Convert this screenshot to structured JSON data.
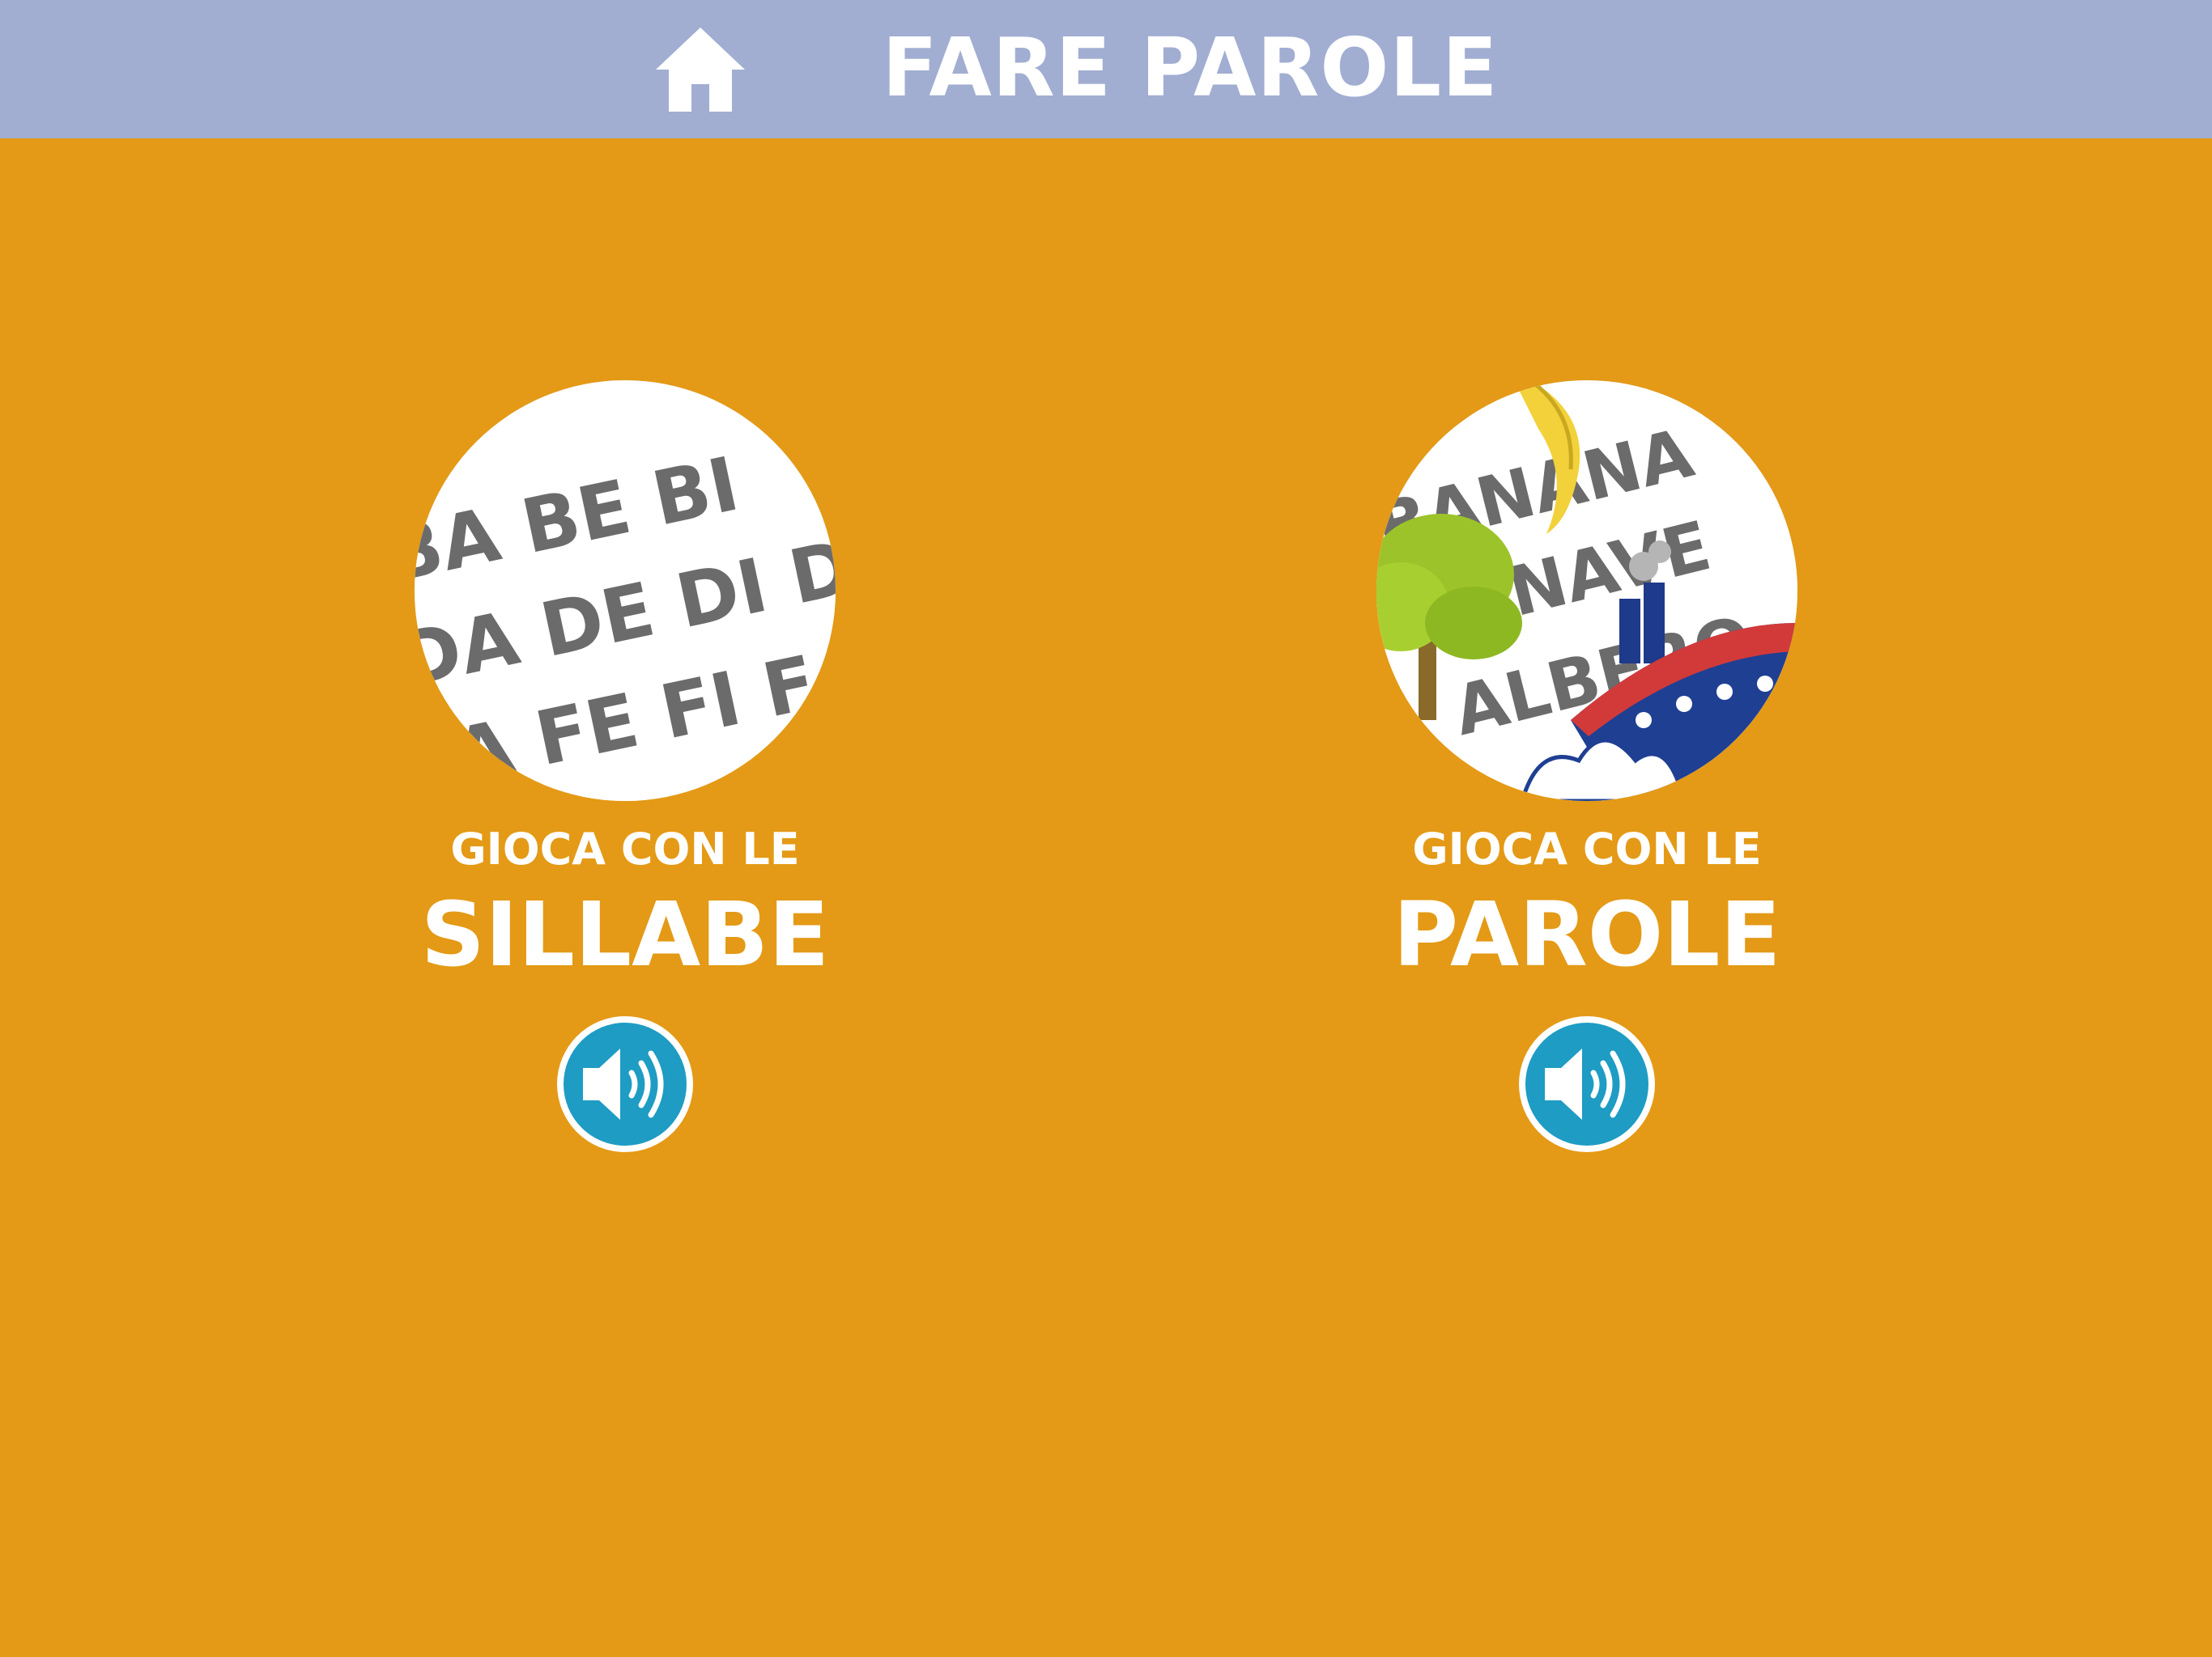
{
  "header": {
    "title": "FARE PAROLE",
    "home_icon": "home-icon",
    "background": "#A1AED2"
  },
  "background_color": "#E49A16",
  "cards": [
    {
      "subtitle": "GIOCA CON LE",
      "title": "SILLABE",
      "thumbnail_lines": [
        "BA BE BI",
        "DA DE DI D",
        "FA FE FI F"
      ],
      "audio_icon": "speaker-icon"
    },
    {
      "subtitle": "GIOCA CON LE",
      "title": "PAROLE",
      "thumbnail_words": [
        "BANANA",
        "NAVE",
        "ALBERO"
      ],
      "audio_icon": "speaker-icon"
    }
  ],
  "colors": {
    "text": "#FFFFFF",
    "audio_button": "#1E9CC3",
    "thumbnail_text": "#6B6B6B"
  }
}
